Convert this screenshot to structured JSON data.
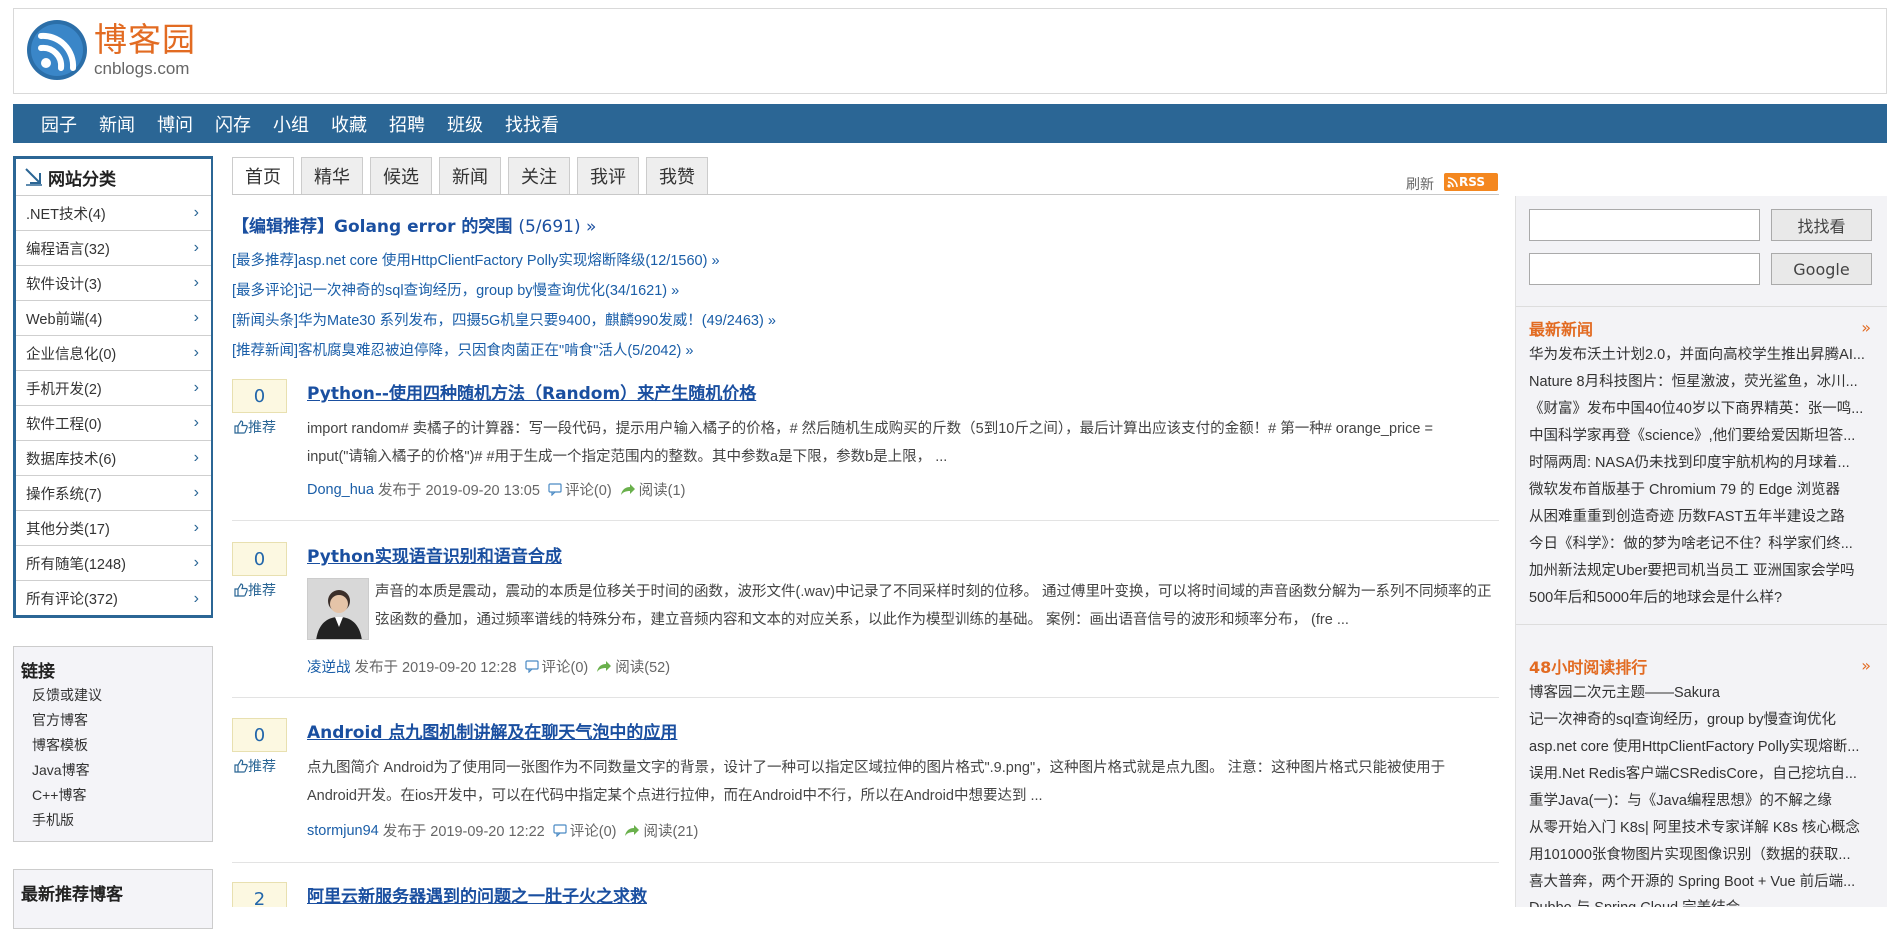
{
  "logo": {
    "cn": "博客园",
    "en": "cnblogs.com"
  },
  "nav": [
    "园子",
    "新闻",
    "博问",
    "闪存",
    "小组",
    "收藏",
    "招聘",
    "班级",
    "找找看"
  ],
  "categories": {
    "title": "网站分类",
    "items": [
      ".NET技术(4)",
      "编程语言(32)",
      "软件设计(3)",
      "Web前端(4)",
      "企业信息化(0)",
      "手机开发(2)",
      "软件工程(0)",
      "数据库技术(6)",
      "操作系统(7)",
      "其他分类(17)",
      "所有随笔(1248)",
      "所有评论(372)"
    ]
  },
  "links": {
    "title": "链接",
    "items": [
      "反馈或建议",
      "官方博客",
      "博客模板",
      "Java博客",
      "C++博客",
      "手机版"
    ]
  },
  "recommend": {
    "title": "最新推荐博客"
  },
  "tabs": [
    "首页",
    "精华",
    "候选",
    "新闻",
    "关注",
    "我评",
    "我赞"
  ],
  "refresh": "刷新",
  "rss": "RSS",
  "picks": {
    "main": "【编辑推荐】Golang error 的突围",
    "main_count": "(5/691) »",
    "items": [
      "[最多推荐]asp.net core 使用HttpClientFactory Polly实现熔断降级(12/1560) »",
      "[最多评论]记一次神奇的sql查询经历，group by慢查询优化(34/1621) »",
      "[新闻头条]华为Mate30 系列发布，四摄5G机皇只要9400，麒麟990发威！(49/2463) »",
      "[推荐新闻]客机腐臭难忍被迫停降，只因食肉菌正在\"啃食\"活人(5/2042) »"
    ]
  },
  "digg_label": "推荐",
  "posts": [
    {
      "digg": "0",
      "title": "Python--使用四种随机方法（Random）来产生随机价格",
      "body": "import random# 卖橘子的计算器：写一段代码，提示用户输入橘子的价格，# 然后随机生成购买的斤数（5到10斤之间），最后计算出应该支付的金额！# 第一种# orange_price = input(\"请输入橘子的价格\")# #用于生成一个指定范围内的整数。其中参数a是下限，参数b是上限，  ...",
      "author": "Dong_hua",
      "posted": "发布于 2019-09-20 13:05",
      "comments": "评论(0)",
      "reads": "阅读(1)"
    },
    {
      "digg": "0",
      "title": "Python实现语音识别和语音合成",
      "body": "声音的本质是震动，震动的本质是位移关于时间的函数，波形文件(.wav)中记录了不同采样时刻的位移。 通过傅里叶变换，可以将时间域的声音函数分解为一系列不同频率的正弦函数的叠加，通过频率谱线的特殊分布，建立音频内容和文本的对应关系，以此作为模型训练的基础。 案例：画出语音信号的波形和频率分布，  (fre ...",
      "author": "凌逆战",
      "posted": "发布于 2019-09-20 12:28",
      "comments": "评论(0)",
      "reads": "阅读(52)"
    },
    {
      "digg": "0",
      "title": "Android 点九图机制讲解及在聊天气泡中的应用",
      "body": "点九图简介 Android为了使用同一张图作为不同数量文字的背景，设计了一种可以指定区域拉伸的图片格式\".9.png\"，这种图片格式就是点九图。 注意：这种图片格式只能被使用于Android开发。在ios开发中，可以在代码中指定某个点进行拉伸，而在Android中不行，所以在Android中想要达到 ...",
      "author": "stormjun94",
      "posted": "发布于 2019-09-20 12:22",
      "comments": "评论(0)",
      "reads": "阅读(21)"
    },
    {
      "digg": "2",
      "title": "阿里云新服务器遇到的问题之一肚子火之求救"
    }
  ],
  "search": {
    "btn1": "找找看",
    "btn2": "Google"
  },
  "latest_news": {
    "title": "最新新闻",
    "more": "»",
    "items": [
      "华为发布沃土计划2.0，并面向高校学生推出昇腾AI...",
      "Nature 8月科技图片：恒星激波，荧光鲨鱼，冰川...",
      "《财富》发布中国40位40岁以下商界精英：张一鸣...",
      "中国科学家再登《science》,他们要给爱因斯坦答...",
      "时隔两周: NASA仍未找到印度宇航机构的月球着...",
      "微软发布首版基于 Chromium 79 的 Edge 浏览器",
      "从困难重重到创造奇迹 历数FAST五年半建设之路",
      "今日《科学》：做的梦为啥老记不住？科学家们终...",
      "加州新法规定Uber要把司机当员工 亚洲国家会学吗",
      "500年后和5000年后的地球会是什么样?"
    ]
  },
  "top48": {
    "title": "48小时阅读排行",
    "more": "»",
    "items": [
      "博客园二次元主题——Sakura",
      "记一次神奇的sql查询经历，group by慢查询优化",
      "asp.net core 使用HttpClientFactory Polly实现熔断...",
      "误用.Net Redis客户端CSRedisCore，自己挖坑自...",
      "重学Java(一)：与《Java编程思想》的不解之缘",
      "从零开始入门 K8s| 阿里技术专家详解 K8s 核心概念",
      "用101000张食物图片实现图像识别（数据的获取...",
      "喜大普奔，两个开源的 Spring Boot + Vue 前后端...",
      "Dubbo 与 Spring Cloud 完美结合"
    ]
  }
}
